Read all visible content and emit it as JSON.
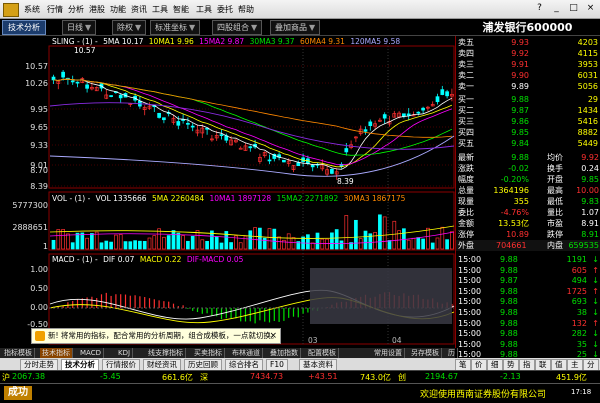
{
  "menubar": {
    "items": [
      "系统",
      "行情",
      "分析",
      "港股",
      "功能",
      "资讯",
      "工具",
      "智能",
      "工具",
      "委托",
      "帮助"
    ],
    "window_controls": [
      "?",
      "_",
      "□",
      "×"
    ]
  },
  "toolbar": {
    "tech_analysis": "技术分析",
    "buttons": [
      "日线",
      "除权",
      "标准坐标",
      "四股组合",
      "叠加商品"
    ],
    "stock_title": "浦发银行600000"
  },
  "price_axis": [
    "10.57",
    "10.26",
    "9.95",
    "9.65",
    "9.33",
    "9.01",
    "8.70",
    "8.39"
  ],
  "price_legend": {
    "name": "SLING - (1) -",
    "ma5": "5MA 10.17",
    "ma10": "10MA1 9.96",
    "ma2": "15MA2 9.87",
    "ma3": "30MA3 9.37",
    "ma4": "60MA4 9.31",
    "ma5b": "120MA5 9.58"
  },
  "price_marks": {
    "high": "10.57",
    "low": "8.39"
  },
  "vol_axis": [
    "5777300",
    "2888651",
    "1"
  ],
  "vol_legend": {
    "name": "VOL - (1) -",
    "vol": "VOL 1335666",
    "ma5": "5MA 2260484",
    "ma10": "10MA1 1897128",
    "ma2": "15MA2 2271892",
    "ma3": "30MA3 1867175"
  },
  "macd_legend": {
    "name": "MACD - (1) -",
    "dif": "DIF 0.07",
    "macd": "MACD 0.22",
    "difmacd": "DIF-MACD 0.05"
  },
  "macd_axis": [
    "1.00",
    "0.50",
    "0.00",
    "-0.50",
    "-1.00"
  ],
  "date_ticks": [
    "03",
    "04"
  ],
  "tooltip": "新! 将常用的指标，配合常用的分析周期，组合成模板，一点就切换。",
  "sell_levels": [
    {
      "label": "卖五",
      "price": "9.93",
      "vol": "4203"
    },
    {
      "label": "卖四",
      "price": "9.92",
      "vol": "4115"
    },
    {
      "label": "卖三",
      "price": "9.91",
      "vol": "3953"
    },
    {
      "label": "卖二",
      "price": "9.90",
      "vol": "6031"
    },
    {
      "label": "卖一",
      "price": "9.89",
      "vol": "5056"
    }
  ],
  "buy_levels": [
    {
      "label": "买一",
      "price": "9.88",
      "vol": "29"
    },
    {
      "label": "买二",
      "price": "9.87",
      "vol": "1434"
    },
    {
      "label": "买三",
      "price": "9.86",
      "vol": "5416"
    },
    {
      "label": "买四",
      "price": "9.85",
      "vol": "8882"
    },
    {
      "label": "买五",
      "price": "9.84",
      "vol": "5449"
    }
  ],
  "stats": [
    {
      "l1": "最新",
      "v1": "9.88",
      "l2": "均价",
      "v2": "9.92"
    },
    {
      "l1": "涨跌",
      "v1": "-0.02",
      "l2": "换手",
      "v2": "0.24"
    },
    {
      "l1": "幅度",
      "v1": "-0.20%",
      "l2": "开盘",
      "v2": "9.85"
    },
    {
      "l1": "总量",
      "v1": "1364196",
      "l2": "最高",
      "v2": "10.00"
    },
    {
      "l1": "现量",
      "v1": "355",
      "l2": "最低",
      "v2": "9.83"
    },
    {
      "l1": "委比",
      "v1": "-4.76%",
      "l2": "量比",
      "v2": "1.07"
    },
    {
      "l1": "金额",
      "v1": "13.53亿",
      "l2": "市盈",
      "v2": "8.91"
    },
    {
      "l1": "涨停",
      "v1": "10.89",
      "l2": "跌停",
      "v2": "8.91"
    }
  ],
  "outin": {
    "out_label": "外盘",
    "out_val": "704661",
    "in_label": "内盘",
    "in_val": "659535"
  },
  "ticks": [
    {
      "time": "15:00",
      "price": "9.88",
      "vol": "1191",
      "dir": "↓"
    },
    {
      "time": "15:00",
      "price": "9.88",
      "vol": "605",
      "dir": "↑"
    },
    {
      "time": "15:00",
      "price": "9.87",
      "vol": "494",
      "dir": "↓"
    },
    {
      "time": "15:00",
      "price": "9.88",
      "vol": "1725",
      "dir": "↑"
    },
    {
      "time": "15:00",
      "price": "9.88",
      "vol": "693",
      "dir": "↓"
    },
    {
      "time": "15:00",
      "price": "9.88",
      "vol": "38",
      "dir": "↓"
    },
    {
      "time": "15:00",
      "price": "9.88",
      "vol": "132",
      "dir": "↑"
    },
    {
      "time": "15:00",
      "price": "9.88",
      "vol": "282",
      "dir": "↓"
    },
    {
      "time": "15:00",
      "price": "9.88",
      "vol": "35",
      "dir": "↓"
    },
    {
      "time": "15:00",
      "price": "9.88",
      "vol": "25",
      "dir": "↓"
    }
  ],
  "tabs1": [
    "指标模板",
    "技术指标",
    "MACD",
    "KDJ",
    "线支撑指标",
    "买卖指标",
    "布林通道",
    "叠加指数",
    "配置模板"
  ],
  "tabs1_right": [
    "常用设置",
    "另存模板",
    "历"
  ],
  "tabs2": [
    "分时走势",
    "技术分析",
    "行情报价",
    "财经资讯",
    "历史回顾",
    "综合排名",
    "F10",
    "基本资料"
  ],
  "tabs2_right": [
    "笔",
    "价",
    "细",
    "势",
    "指",
    "联",
    "值",
    "主",
    "分"
  ],
  "status": {
    "sh_label": "沪",
    "sh_index": "2067.38",
    "sh_change": "-5.45",
    "sh_amount": "661.6亿",
    "sz_label": "深",
    "sz_index": "7434.73",
    "sz_change": "+43.51",
    "sz_amount": "743.0亿",
    "extra_label": "创",
    "extra_index": "2194.67",
    "extra_change": "-2.13",
    "extra_amount": "451.9亿"
  },
  "ticker": {
    "logo": "成功",
    "message": "欢迎使用西南证券股份有限公司",
    "time": "17:18"
  },
  "colors": {
    "up": "#ff3030",
    "down": "#00e000",
    "ma5": "#ffffff",
    "ma10": "#ffff00",
    "ma2": "#ff00ff",
    "ma3": "#00ff00",
    "ma4": "#ff8800",
    "ma5b": "#aaaaff"
  }
}
